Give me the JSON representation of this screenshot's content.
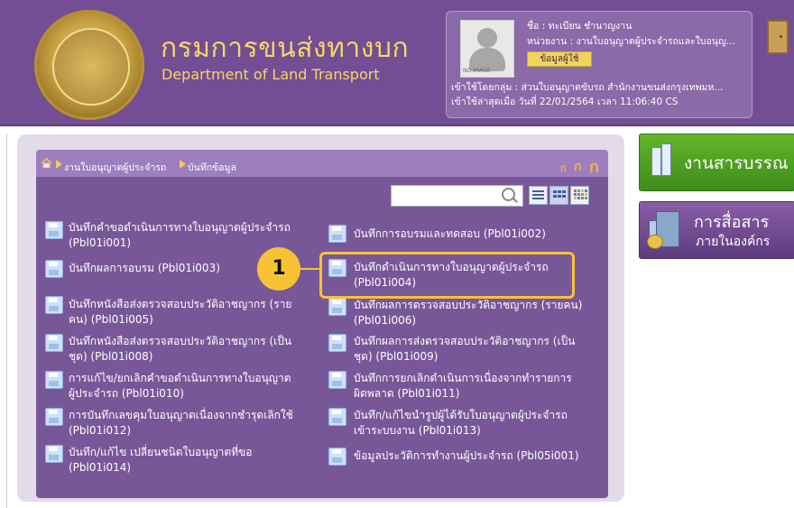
{
  "header": {
    "brand_th": "กรมการขนส่งทางบก",
    "brand_en": "Department of Land Transport"
  },
  "user": {
    "name": "ชื่อ : ทะเบียน ชำนาญงาน",
    "unit": "หน่วยงาน : งานใบอนุญาตผู้ประจำรถและใบอนุญ...",
    "profile_button": "ข้อมูลผู้ใช้",
    "group": "เข้าใช้โดยกลุ่ม : ส่วนใบอนุญาตขับรถ สำนักงานขนส่งกรุงเทพมห...",
    "last_login": "เข้าใช้ล่าสุดเมื่อ วันที่ 22/01/2564 เวลา 11:06:40 CS",
    "avatar_placeholder": "NO IMAGE"
  },
  "breadcrumb": {
    "items": [
      "งานใบอนุญาตผู้ประจำรถ",
      "บันทึกข้อมูล"
    ]
  },
  "font_size_controls": [
    "ก",
    "ก",
    "ก"
  ],
  "menu": {
    "left": [
      [
        "บันทึกคำขอดำเนินการทางใบอนุญาตผู้ประจำรถ",
        "(Pbl01i001)"
      ],
      [
        "บันทึกผลการอบรม (Pbl01i003)"
      ],
      [
        "บันทึกหนังสือส่งตรวจสอบประวัติอาชญากร (ราย",
        "คน) (Pbl01i005)"
      ],
      [
        "บันทึกหนังสือส่งตรวจสอบประวัติอาชญากร (เป็น",
        "ชุด) (Pbl01i008)"
      ],
      [
        "การแก้ไข/ยกเลิกคำขอดำเนินการทางใบอนุญาต",
        "ผู้ประจำรถ (Pbl01i010)"
      ],
      [
        "การบันทึกเลขคุมใบอนุญาตเนื่องจากชำรุดเลิกใช้",
        "(Pbl01i012)"
      ],
      [
        "บันทึก/แก้ไข เปลี่ยนชนิดใบอนุญาตที่ขอ",
        "(Pbl01i014)"
      ]
    ],
    "right": [
      [
        "บันทึกการอบรมและทดสอบ (Pbl01i002)"
      ],
      [
        "บันทึกดำเนินการทางใบอนุญาตผู้ประจำรถ",
        "(Pbl01i004)"
      ],
      [
        "บันทึกผลการตรวจสอบประวัติอาชญากร (รายคน)",
        "(Pbl01i006)"
      ],
      [
        "บันทึกผลการส่งตรวจสอบประวัติอาชญากร (เป็น",
        "ชุด) (Pbl01i009)"
      ],
      [
        "บันทึกการยกเลิกดำเนินการเนื่องจากทำรายการ",
        "ผิดพลาด (Pbl01i011)"
      ],
      [
        "บันทึก/แก้ไขนำรูปผู้ได้รับใบอนุญาตผู้ประจำรถ",
        "เข้าระบบงาน (Pbl01i013)"
      ],
      [
        "ข้อมูลประวัติการทำงานผู้ประจำรถ (Pbl05i001)"
      ]
    ]
  },
  "callout": {
    "number": "1"
  },
  "side": {
    "records": "งานสารบรรณ",
    "comm_line1": "การสื่อสาร",
    "comm_line2": "ภายในองค์กร"
  },
  "colors": {
    "header_purple": "#744e94",
    "gold_text": "#f4d76a",
    "panel_purple": "#785799",
    "highlight_yellow": "#f7c234",
    "green_button": "#4f9e22"
  }
}
